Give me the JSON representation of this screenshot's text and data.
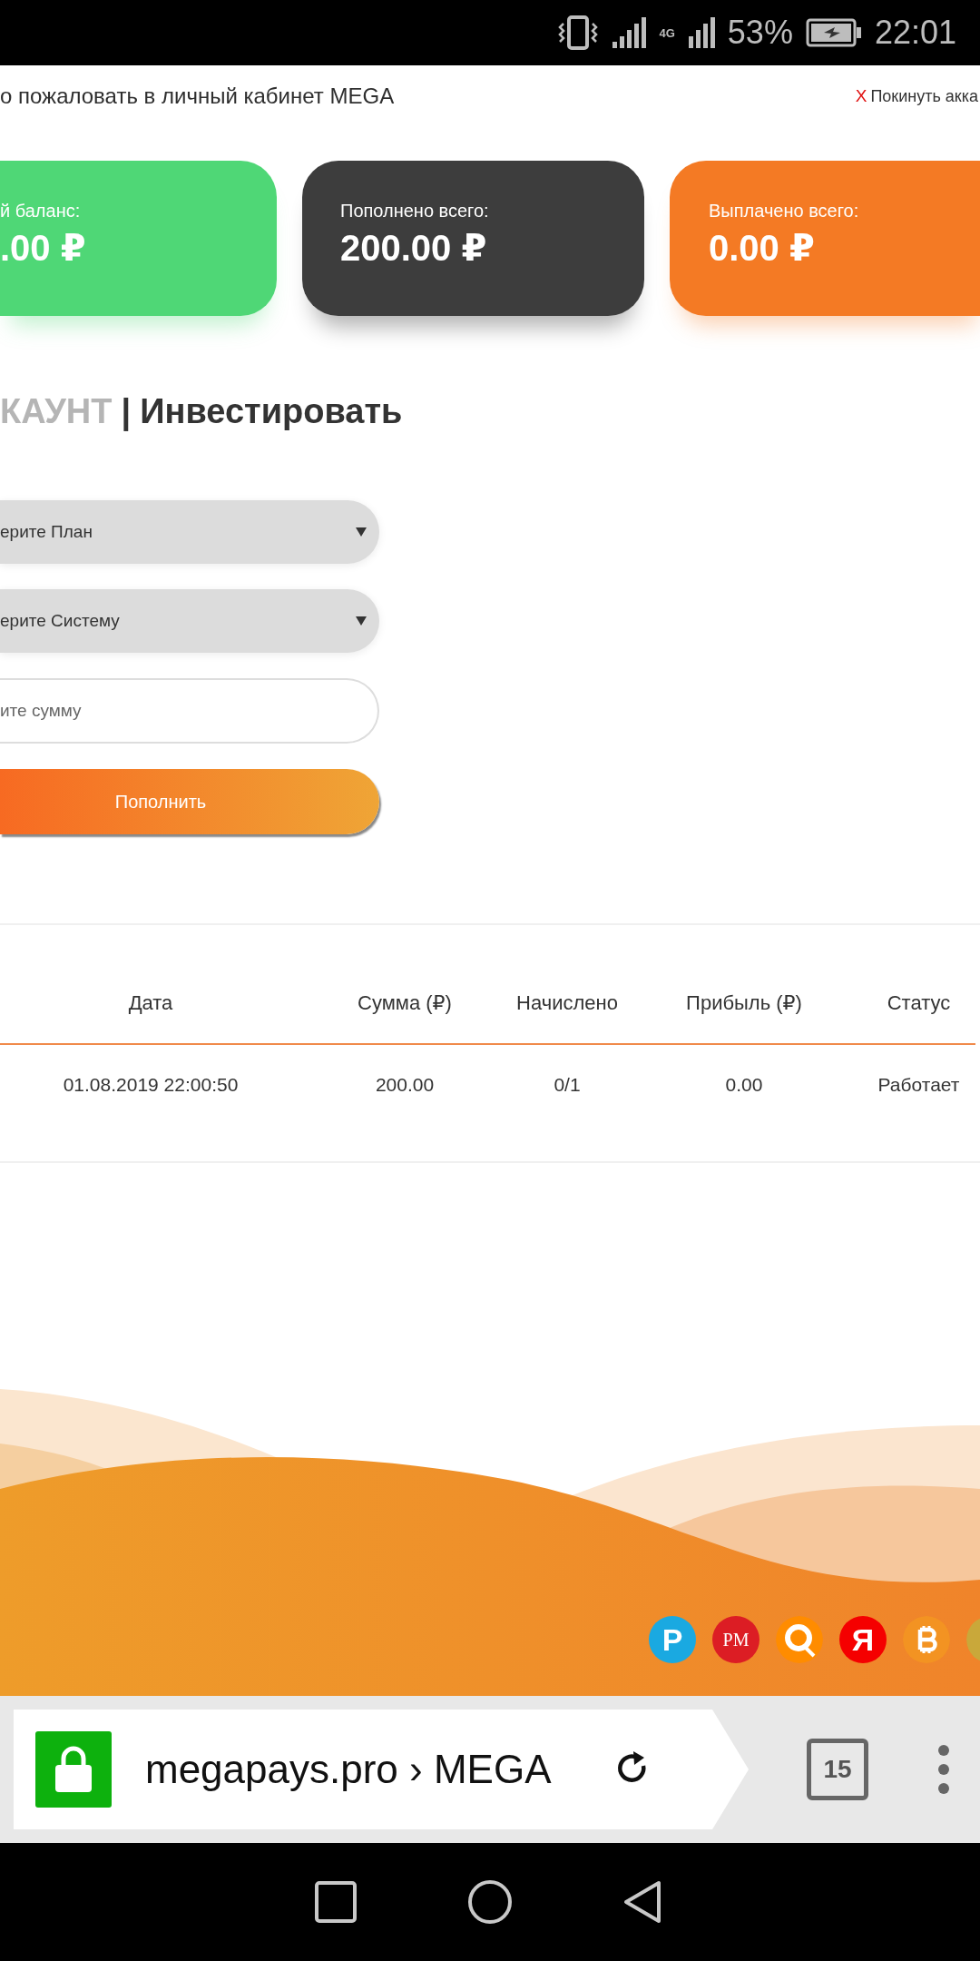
{
  "status_bar": {
    "network": "4G",
    "battery": "53%",
    "time": "22:01"
  },
  "header": {
    "welcome": "о пожаловать в личный кабинет MEGA",
    "logout_mark": "X",
    "logout": "Покинуть акка"
  },
  "cards": [
    {
      "label": "й баланс:",
      "value": ".00 ₽",
      "color": "#4fd776"
    },
    {
      "label": "Пополнено всего:",
      "value": "200.00 ₽",
      "color": "#3d3d3d"
    },
    {
      "label": "Выплачено всего:",
      "value": "0.00 ₽",
      "color": "#f47a24"
    }
  ],
  "section": {
    "crumb": "КАУНТ",
    "separator": "|",
    "title": "Инвестировать"
  },
  "form": [
    {
      "kind": "select",
      "value": "ерите План"
    },
    {
      "kind": "select",
      "value": "ерите Систему"
    },
    {
      "kind": "input",
      "placeholder": "ите сумму"
    },
    {
      "kind": "button",
      "label": "Пополнить"
    }
  ],
  "table": {
    "columns": [
      "Дата",
      "Сумма (₽)",
      "Начислено",
      "Прибыль (₽)",
      "Статус"
    ],
    "rows": [
      [
        "01.08.2019 22:00:50",
        "200.00",
        "0/1",
        "0.00",
        "Работает"
      ]
    ]
  },
  "payment_badges": [
    {
      "kind": "letter",
      "text": "P",
      "color": "#1aa9e1"
    },
    {
      "kind": "serif",
      "text": "PM",
      "color": "#dc1d24"
    },
    {
      "kind": "qiwi",
      "color": "#ff8c00"
    },
    {
      "kind": "letter",
      "text": "Я",
      "color": "#f50000"
    },
    {
      "kind": "bitcoin",
      "color": "#f39322"
    },
    {
      "kind": "blank",
      "color": "#c9a83a"
    }
  ],
  "browser": {
    "url": "megapays.pro › MEGA",
    "tab_count": "15"
  }
}
